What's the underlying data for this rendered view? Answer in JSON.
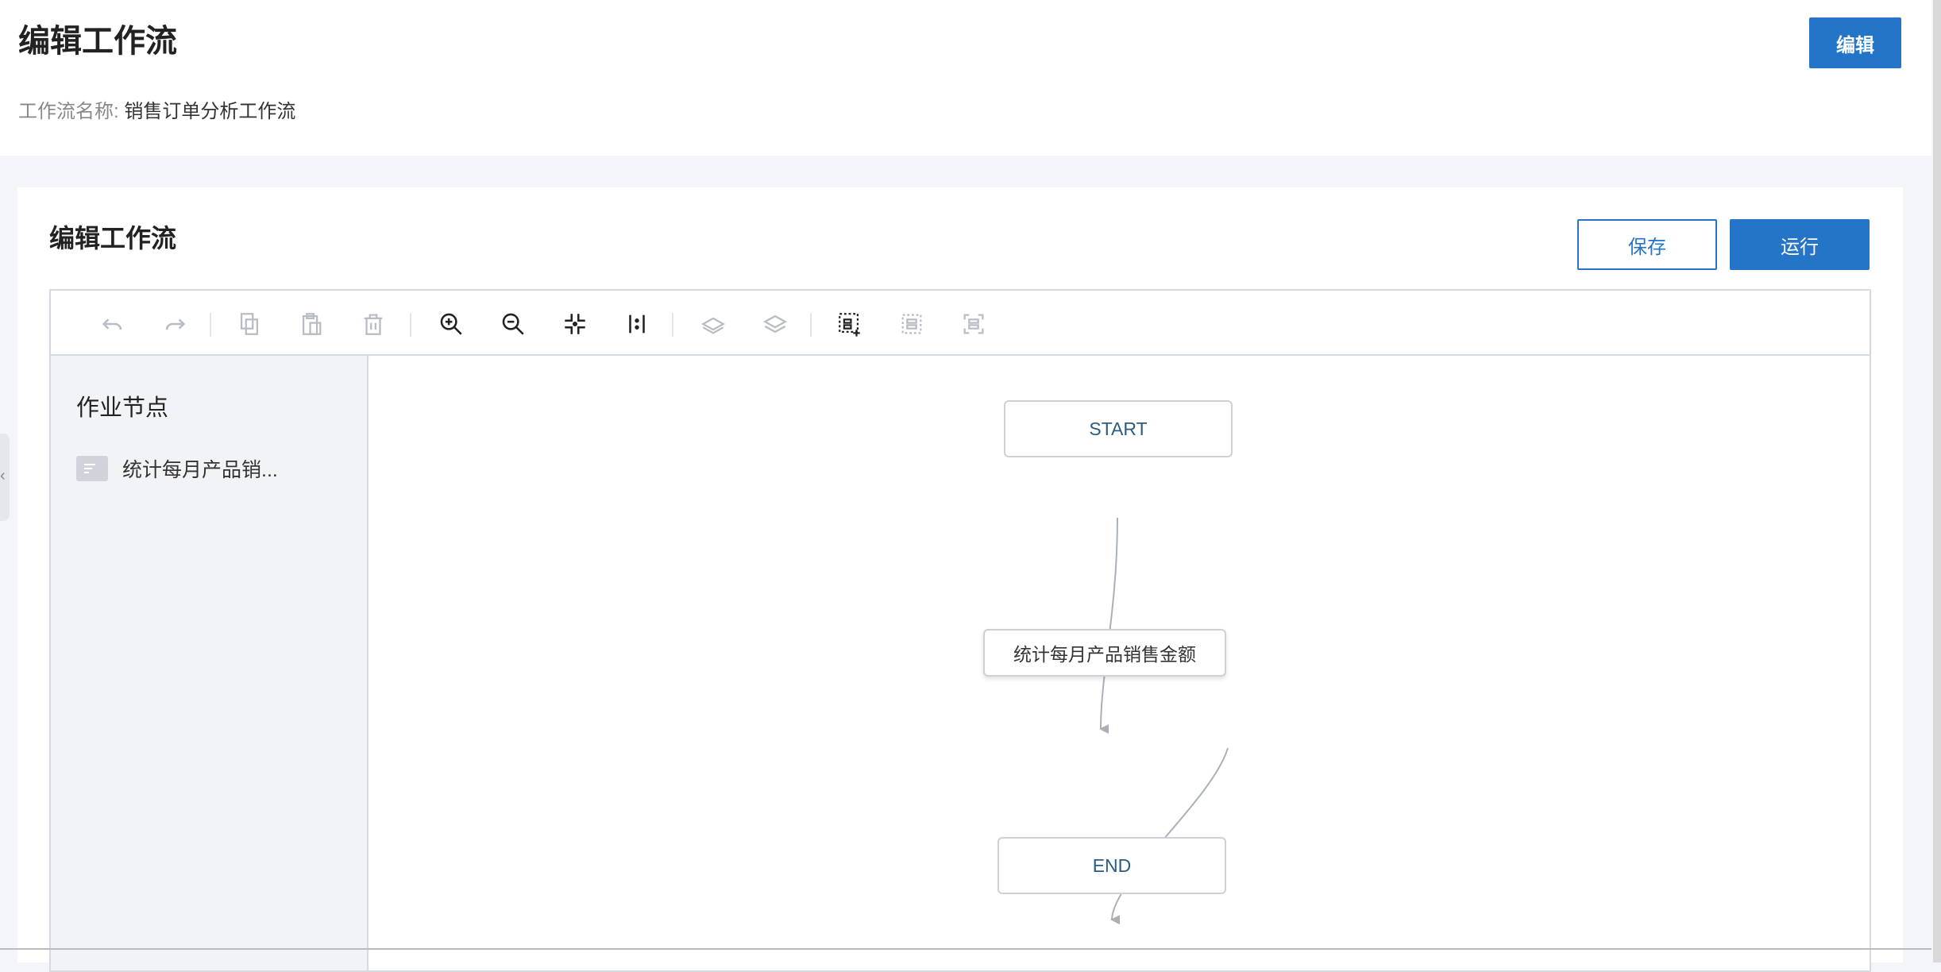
{
  "header": {
    "title": "编辑工作流",
    "name_label": "工作流名称:",
    "name_value": "销售订单分析工作流",
    "edit_label": "编辑"
  },
  "editor_card": {
    "title": "编辑工作流",
    "save_label": "保存",
    "run_label": "运行"
  },
  "toolbar": {
    "buttons": [
      {
        "icon": "undo-icon",
        "enabled": false
      },
      {
        "icon": "redo-icon",
        "enabled": false
      },
      {
        "icon": "copy-icon",
        "enabled": false
      },
      {
        "icon": "paste-icon",
        "enabled": false
      },
      {
        "icon": "delete-icon",
        "enabled": false
      },
      {
        "icon": "zoom-in-icon",
        "enabled": true
      },
      {
        "icon": "zoom-out-icon",
        "enabled": true
      },
      {
        "icon": "fit-view-icon",
        "enabled": true
      },
      {
        "icon": "actual-size-icon",
        "enabled": true
      },
      {
        "icon": "to-back-icon",
        "enabled": false
      },
      {
        "icon": "to-front-icon",
        "enabled": false
      },
      {
        "icon": "multi-select-icon",
        "enabled": true
      },
      {
        "icon": "group-icon",
        "enabled": false
      },
      {
        "icon": "ungroup-icon",
        "enabled": false
      }
    ]
  },
  "sidebar": {
    "title": "作业节点",
    "items": [
      {
        "label": "统计每月产品销...",
        "icon": "job-node-icon"
      }
    ]
  },
  "flow": {
    "nodes": [
      {
        "id": "start",
        "label": "START"
      },
      {
        "id": "job1",
        "label": "统计每月产品销售金额"
      },
      {
        "id": "end",
        "label": "END"
      }
    ]
  },
  "colors": {
    "primary": "#2475c8",
    "terminal_text": "#2a5b80",
    "edge": "#a9b0b8"
  }
}
